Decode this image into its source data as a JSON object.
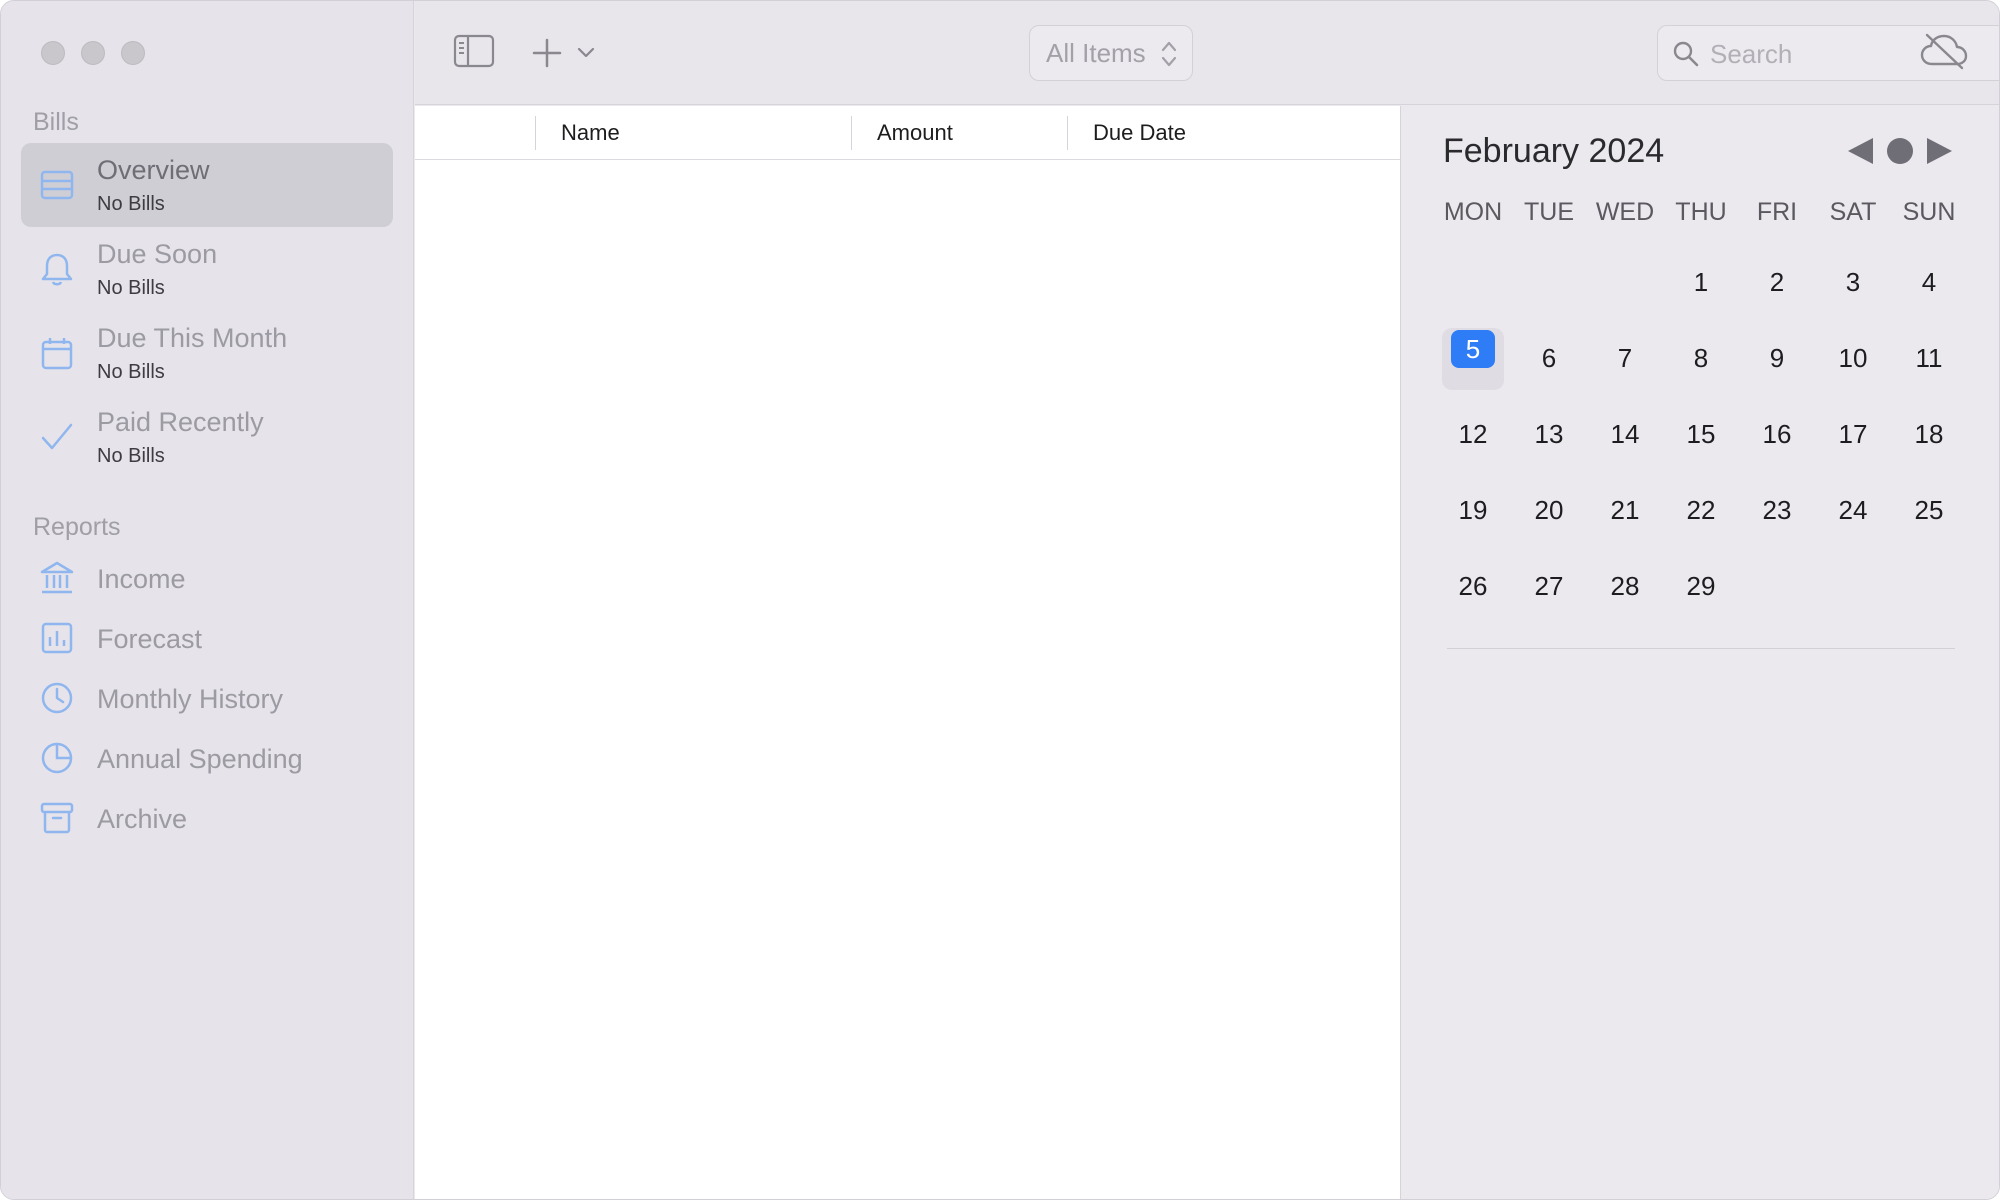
{
  "sidebar": {
    "bills_label": "Bills",
    "items": [
      {
        "title": "Overview",
        "subtitle": "No Bills",
        "icon": "list-icon"
      },
      {
        "title": "Due Soon",
        "subtitle": "No Bills",
        "icon": "bell-icon"
      },
      {
        "title": "Due This Month",
        "subtitle": "No Bills",
        "icon": "calendar-icon"
      },
      {
        "title": "Paid Recently",
        "subtitle": "No Bills",
        "icon": "checkmark-icon"
      }
    ],
    "reports_label": "Reports",
    "reports": [
      {
        "title": "Income",
        "icon": "bank-icon"
      },
      {
        "title": "Forecast",
        "icon": "bar-chart-icon"
      },
      {
        "title": "Monthly History",
        "icon": "clock-icon"
      },
      {
        "title": "Annual Spending",
        "icon": "pie-chart-icon"
      },
      {
        "title": "Archive",
        "icon": "archive-box-icon"
      }
    ]
  },
  "toolbar": {
    "filter_value": "All Items",
    "search_placeholder": "Search"
  },
  "table": {
    "columns": [
      "Name",
      "Amount",
      "Due Date"
    ]
  },
  "calendar": {
    "month_label": "February 2024",
    "weekdays": [
      "MON",
      "TUE",
      "WED",
      "THU",
      "FRI",
      "SAT",
      "SUN"
    ],
    "weeks": [
      [
        "",
        "",
        "",
        "1",
        "2",
        "3",
        "4"
      ],
      [
        "5",
        "6",
        "7",
        "8",
        "9",
        "10",
        "11"
      ],
      [
        "12",
        "13",
        "14",
        "15",
        "16",
        "17",
        "18"
      ],
      [
        "19",
        "20",
        "21",
        "22",
        "23",
        "24",
        "25"
      ],
      [
        "26",
        "27",
        "28",
        "29",
        "",
        "",
        ""
      ]
    ],
    "today": "5"
  },
  "colors": {
    "accent": "#2f7df6",
    "icon_tint": "#8fb6ee"
  }
}
